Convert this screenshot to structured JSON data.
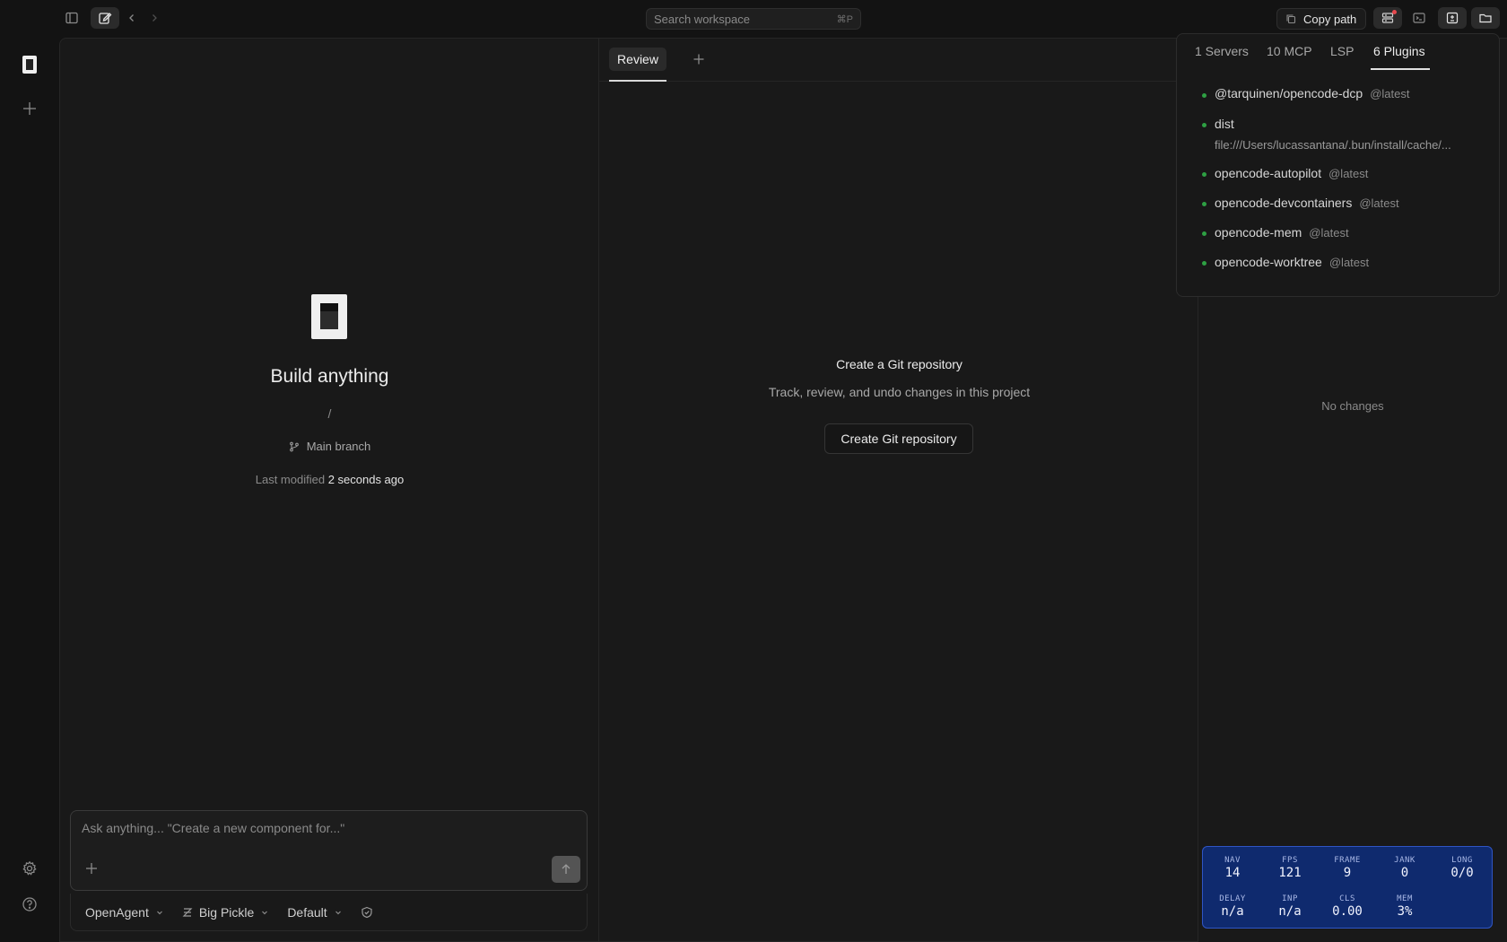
{
  "topbar": {
    "search_placeholder": "Search workspace",
    "search_shortcut": "⌘P",
    "copy_path_label": "Copy path"
  },
  "main": {
    "title": "Build anything",
    "path": "/",
    "branch": "Main branch",
    "modified_label": "Last modified",
    "modified_value": "2 seconds ago"
  },
  "prompt": {
    "placeholder": "Ask anything... \"Create a new component for...\"",
    "agent": "OpenAgent",
    "model": "Big Pickle",
    "variant": "Default"
  },
  "review": {
    "tab_label": "Review",
    "git_title": "Create a Git repository",
    "git_subtitle": "Track, review, and undo changes in this project",
    "git_button": "Create Git repository",
    "no_changes": "No changes"
  },
  "popover": {
    "tabs": [
      "1 Servers",
      "10 MCP",
      "LSP",
      "6 Plugins"
    ],
    "active_tab": "6 Plugins",
    "plugins": [
      {
        "name": "@tarquinen/opencode-dcp",
        "version": "@latest"
      },
      {
        "name": "dist",
        "path": "file:///Users/lucassantana/.bun/install/cache/..."
      },
      {
        "name": "opencode-autopilot",
        "version": "@latest"
      },
      {
        "name": "opencode-devcontainers",
        "version": "@latest"
      },
      {
        "name": "opencode-mem",
        "version": "@latest"
      },
      {
        "name": "opencode-worktree",
        "version": "@latest"
      }
    ],
    "status_color": "#2ea043"
  },
  "perf": {
    "row1": [
      {
        "k": "NAV",
        "v": "14"
      },
      {
        "k": "FPS",
        "v": "121"
      },
      {
        "k": "FRAME",
        "v": "9"
      },
      {
        "k": "JANK",
        "v": "0"
      },
      {
        "k": "LONG",
        "v": "0/0"
      }
    ],
    "row2": [
      {
        "k": "DELAY",
        "v": "n/a"
      },
      {
        "k": "INP",
        "v": "n/a"
      },
      {
        "k": "CLS",
        "v": "0.00"
      },
      {
        "k": "MEM",
        "v": "3%"
      }
    ]
  },
  "colors": {
    "background": "#131313",
    "panel": "#191919",
    "perf_bg": "#0f2a6e",
    "notification_dot": "#e5484d"
  }
}
